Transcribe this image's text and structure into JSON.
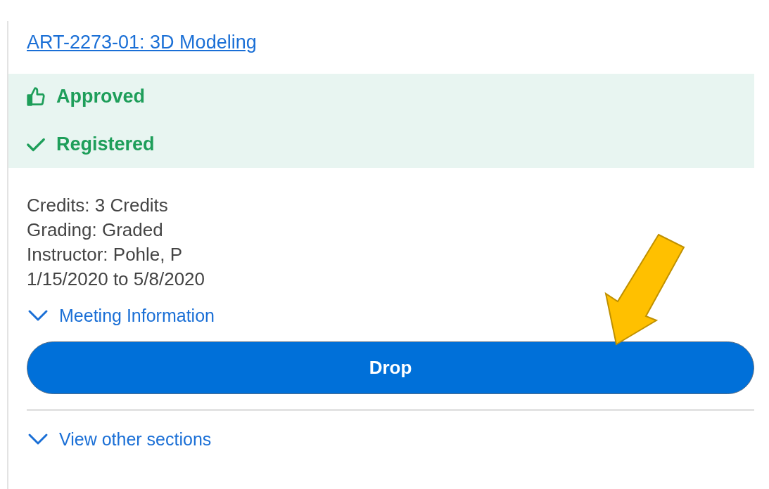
{
  "course": {
    "title": "ART-2273-01: 3D Modeling"
  },
  "statuses": [
    {
      "kind": "approved",
      "label": "Approved"
    },
    {
      "kind": "registered",
      "label": "Registered"
    }
  ],
  "details": [
    "Credits: 3 Credits",
    "Grading: Graded",
    "Instructor: Pohle, P",
    "1/15/2020 to 5/8/2020"
  ],
  "meeting_toggle": {
    "label": "Meeting Information",
    "expanded": false
  },
  "drop_button": {
    "label": "Drop"
  },
  "sections_toggle": {
    "label": "View other sections",
    "expanded": false
  }
}
